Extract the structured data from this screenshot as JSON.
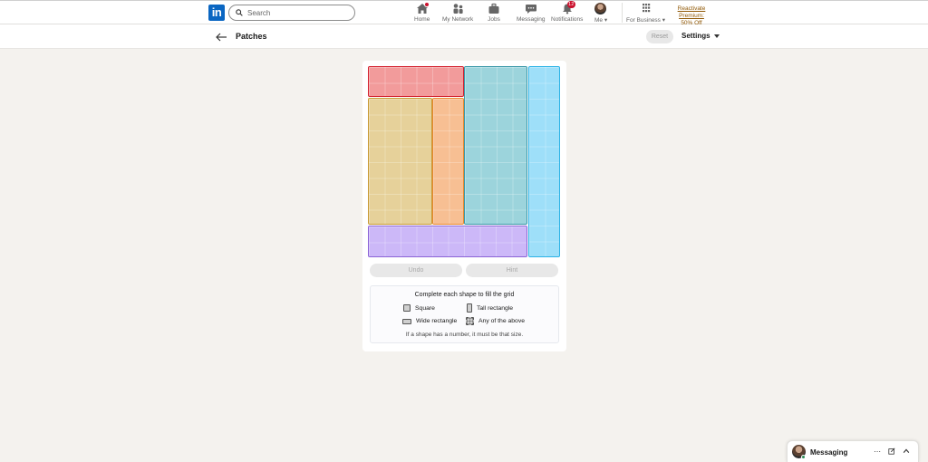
{
  "nav": {
    "logo_text": "in",
    "search_placeholder": "Search",
    "items": [
      {
        "label": "Home",
        "icon": "home-icon",
        "badge": ""
      },
      {
        "label": "My Network",
        "icon": "network-icon",
        "badge": ""
      },
      {
        "label": "Jobs",
        "icon": "briefcase-icon",
        "badge": ""
      },
      {
        "label": "Messaging",
        "icon": "chat-icon",
        "badge": ""
      },
      {
        "label": "Notifications",
        "icon": "bell-icon",
        "badge": "12"
      },
      {
        "label": "Me",
        "icon": "avatar",
        "badge": ""
      },
      {
        "label": "For Business",
        "icon": "grid-icon",
        "badge": ""
      }
    ],
    "premium_line1": "Reactivate Premium:",
    "premium_line2": "50% Off"
  },
  "header": {
    "title": "Patches",
    "reset_label": "Reset",
    "settings_label": "Settings"
  },
  "game": {
    "undo_label": "Undo",
    "hint_label": "Hint",
    "pieces": [
      {
        "name": "red",
        "color": "#f29b9b"
      },
      {
        "name": "yellow",
        "color": "#e6d19a"
      },
      {
        "name": "orange",
        "color": "#f7bf93"
      },
      {
        "name": "teal",
        "color": "#9cd4dc"
      },
      {
        "name": "blue",
        "color": "#9edff9"
      },
      {
        "name": "purple",
        "color": "#ccb8f8"
      }
    ],
    "legend": {
      "title": "Complete each shape to fill the grid",
      "square": "Square",
      "tall": "Tall rectangle",
      "wide": "Wide rectangle",
      "any": "Any of the above",
      "note": "If a shape has a number, it must be that size."
    }
  },
  "messaging": {
    "title": "Messaging"
  }
}
